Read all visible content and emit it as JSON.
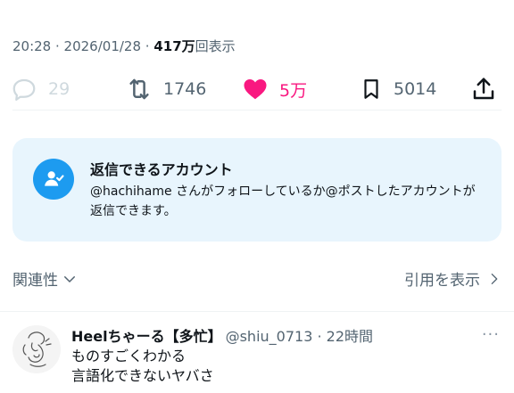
{
  "meta": {
    "time": "20:28",
    "sep1": " · ",
    "date": "2026/01/28",
    "sep2": " · ",
    "views_count": "417万",
    "views_label": "回表示"
  },
  "actions": {
    "replies": "29",
    "reposts": "1746",
    "likes": "5万",
    "bookmarks": "5014"
  },
  "reply_card": {
    "title": "返信できるアカウント",
    "description": "@hachihame さんがフォローしているか@ポストしたアカウントが返信できます。"
  },
  "sort": {
    "relevance": "関連性",
    "view_quotes": "引用を表示"
  },
  "reply": {
    "name": "Heelちゃーる【多忙】",
    "handle": "@shiu_0713",
    "sep": " · ",
    "time": "22時間",
    "more": "···",
    "line1": "ものすごくわかる",
    "line2": "言語化できないヤバさ"
  },
  "colors": {
    "like": "#f91880",
    "accent": "#1d9bf0",
    "muted": "#536471",
    "card_bg": "#e8f5fd"
  },
  "icons": [
    "reply-icon",
    "repost-icon",
    "like-icon",
    "bookmark-icon",
    "share-icon",
    "reply-permission-icon",
    "chevron-down-icon",
    "chevron-right-icon",
    "more-icon"
  ]
}
